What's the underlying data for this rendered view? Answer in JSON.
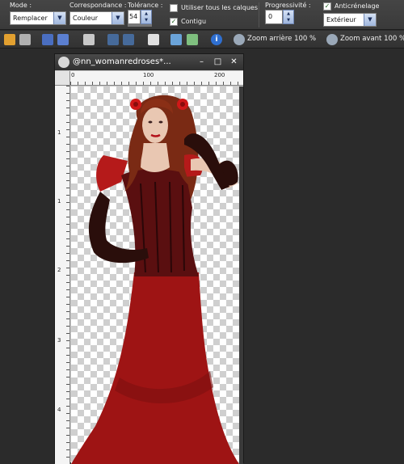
{
  "options": {
    "mode_label": "Mode :",
    "mode_value": "Remplacer",
    "match_label": "Correspondance :",
    "match_value": "Couleur",
    "tolerance_label": "Tolérance :",
    "tolerance_value": "54",
    "use_all_layers_label": "Utiliser tous les calques",
    "use_all_layers_checked": false,
    "contiguous_label": "Contigu",
    "contiguous_checked": true,
    "feather_label": "Progressivité :",
    "feather_value": "0",
    "antialias_label": "Anticrénelage",
    "antialias_checked": true,
    "antialias_value": "Extérieur"
  },
  "toolbar": {
    "icons": [
      "browse-icon",
      "open-icon",
      "save-icon",
      "save-as-icon",
      "print-icon",
      "undo-icon",
      "redo-icon",
      "new-layer-icon",
      "adjust-icon",
      "effects-icon",
      "info-icon"
    ],
    "zoom_out_label": "Zoom arrière 100 %",
    "zoom_in_label": "Zoom avant 100 %"
  },
  "document": {
    "title": "@nn_womanredroses*...",
    "ruler_h_labels": [
      "0",
      "100",
      "200"
    ],
    "ruler_v_labels": [
      "1",
      "1",
      "2",
      "3",
      "4"
    ]
  },
  "colors": {
    "workspace": "#2b2b2b",
    "dress": "#9e1414",
    "corset": "#5a0f10",
    "hair": "#7a2a14",
    "skin": "#e9c7b2",
    "glove": "#2a0e0b",
    "rose": "#d01818"
  }
}
